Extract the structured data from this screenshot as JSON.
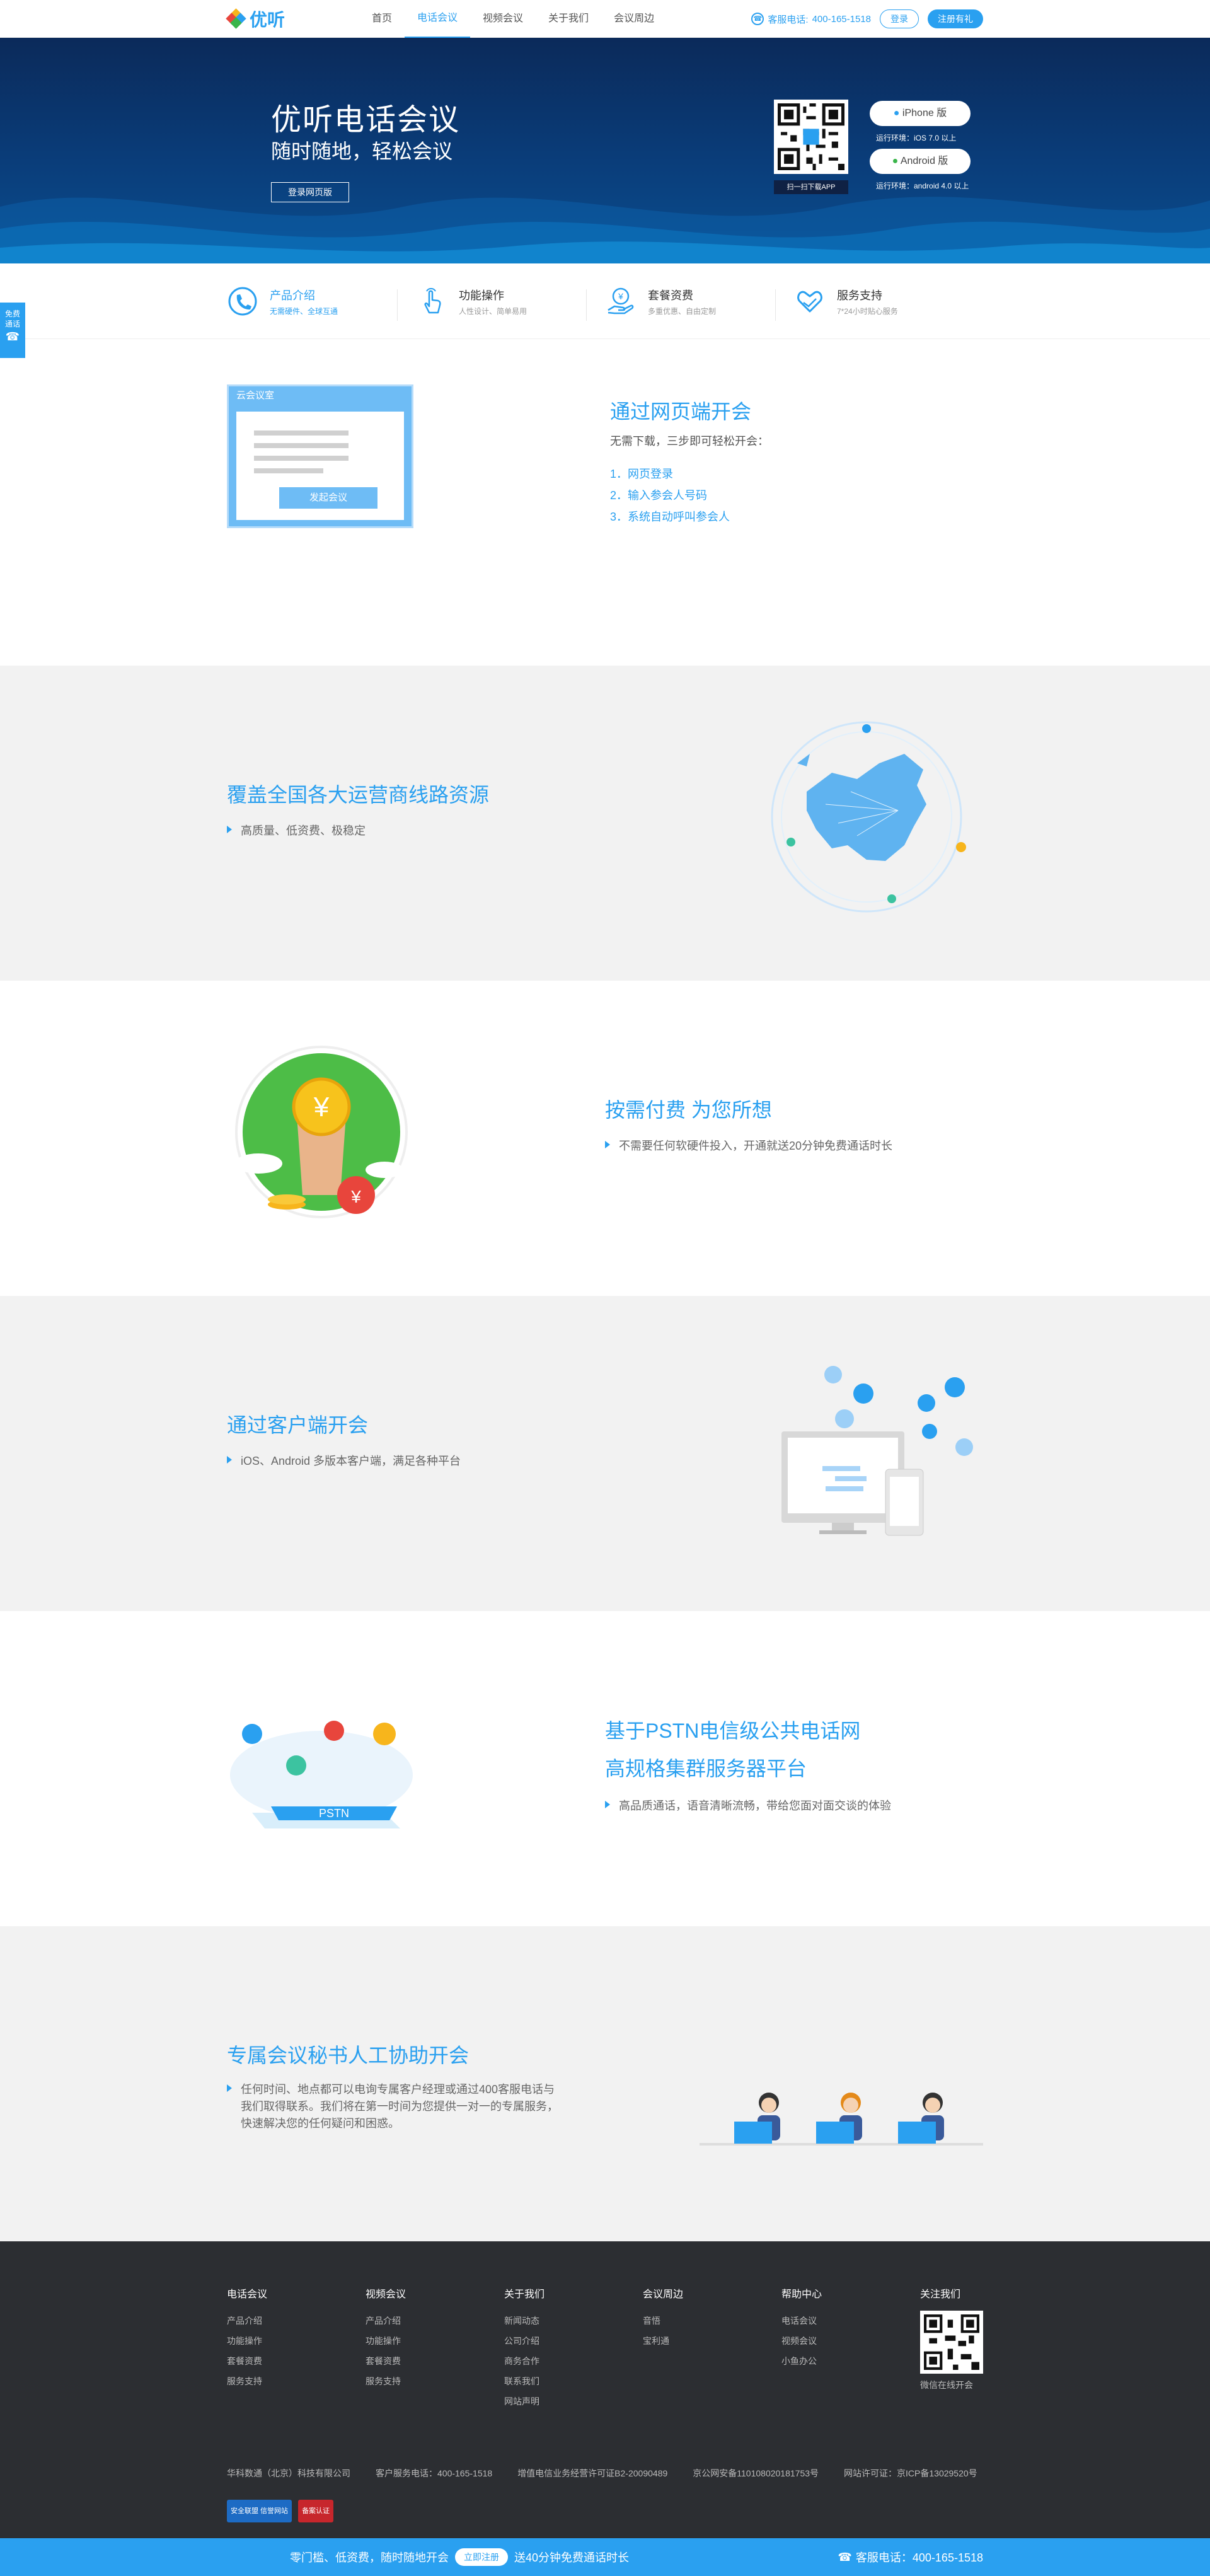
{
  "header": {
    "logo_text": "优听",
    "nav": [
      "首页",
      "电话会议",
      "视频会议",
      "关于我们",
      "会议周边"
    ],
    "active_nav": "电话会议",
    "hotline_label": "客服电话:",
    "hotline_number": "400-165-1518",
    "login_label": "登录",
    "register_label": "注册有礼"
  },
  "banner": {
    "title": "优听电话会议",
    "subtitle": "随时随地，轻松会议",
    "web_login_button": "登录网页版",
    "qr_caption": "扫一扫下载APP",
    "iphone_label": "iPhone 版",
    "iphone_env": "运行环境：iOS 7.0 以上",
    "android_label": "Android 版",
    "android_env": "运行环境：android 4.0 以上"
  },
  "features": [
    {
      "title": "产品介绍",
      "desc": "无需硬件、全球互通",
      "icon": "phone-icon",
      "active": true
    },
    {
      "title": "功能操作",
      "desc": "人性设计、简单易用",
      "icon": "hand-pointer-icon",
      "active": false
    },
    {
      "title": "套餐资费",
      "desc": "多重优惠、自由定制",
      "icon": "yen-hand-icon",
      "active": false
    },
    {
      "title": "服务支持",
      "desc": "7*24小时贴心服务",
      "icon": "heart-hand-icon",
      "active": false
    }
  ],
  "side_float": {
    "label": "免费通话"
  },
  "sec_web": {
    "mock_title": "云会议室",
    "mock_button": "发起会议",
    "title": "通过网页端开会",
    "intro": "无需下载，三步即可轻松开会：",
    "steps": [
      "1．网页登录",
      "2．输入参会人号码",
      "3．系统自动呼叫参会人"
    ]
  },
  "sec_coverage": {
    "title": "覆盖全国各大运营商线路资源",
    "bullet": "高质量、低资费、极稳定"
  },
  "sec_pay": {
    "title": "按需付费 为您所想",
    "bullet": "不需要任何软硬件投入，开通就送20分钟免费通话时长"
  },
  "sec_client": {
    "title": "通过客户端开会",
    "bullet": "iOS、Android 多版本客户端，满足各种平台"
  },
  "sec_pstn": {
    "title_1": "基于PSTN电信级公共电话网",
    "title_2": "高规格集群服务器平台",
    "bullet": "高品质通话，语音清晰流畅，带给您面对面交谈的体验",
    "pstn_label": "PSTN"
  },
  "sec_secretary": {
    "title": "专属会议秘书人工协助开会",
    "bullet_lines": [
      "任何时间、地点都可以电询专属客户经理或通过400客服电话与",
      "我们取得联系。我们将在第一时间为您提供一对一的专属服务，",
      "快速解决您的任何疑问和困惑。"
    ]
  },
  "footer": {
    "columns": [
      {
        "title": "电话会议",
        "links": [
          "产品介绍",
          "功能操作",
          "套餐资费",
          "服务支持"
        ]
      },
      {
        "title": "视频会议",
        "links": [
          "产品介绍",
          "功能操作",
          "套餐资费",
          "服务支持"
        ]
      },
      {
        "title": "关于我们",
        "links": [
          "新闻动态",
          "公司介绍",
          "商务合作",
          "联系我们",
          "网站声明"
        ]
      },
      {
        "title": "会议周边",
        "links": [
          "音悟",
          "宝利通"
        ]
      },
      {
        "title": "帮助中心",
        "links": [
          "电话会议",
          "视频会议",
          "小鱼办公"
        ]
      }
    ],
    "follow_title": "关注我们",
    "qr_caption": "微信在线开会",
    "company": "华科数通（北京）科技有限公司",
    "service_phone": "客户服务电话：400-165-1518",
    "license_1": "增值电信业务经营许可证B2-20090489",
    "license_2": "京公网安备110108020181753号",
    "icp": "网站许可证：京ICP备13029520号",
    "badges": [
      "安全联盟 信誉网站",
      "备案认证"
    ]
  },
  "bottom_bar": {
    "text_left": "零门槛、低资费，随时随地开会",
    "button": "立即注册",
    "text_right": "送40分钟免费通话时长",
    "hotline": "客服电话：400-165-1518"
  },
  "colors": {
    "brand": "#2aa0f0",
    "banner_dark": "#0b2a5a",
    "footer": "#2c2e32",
    "section_grey": "#f2f2f2"
  }
}
